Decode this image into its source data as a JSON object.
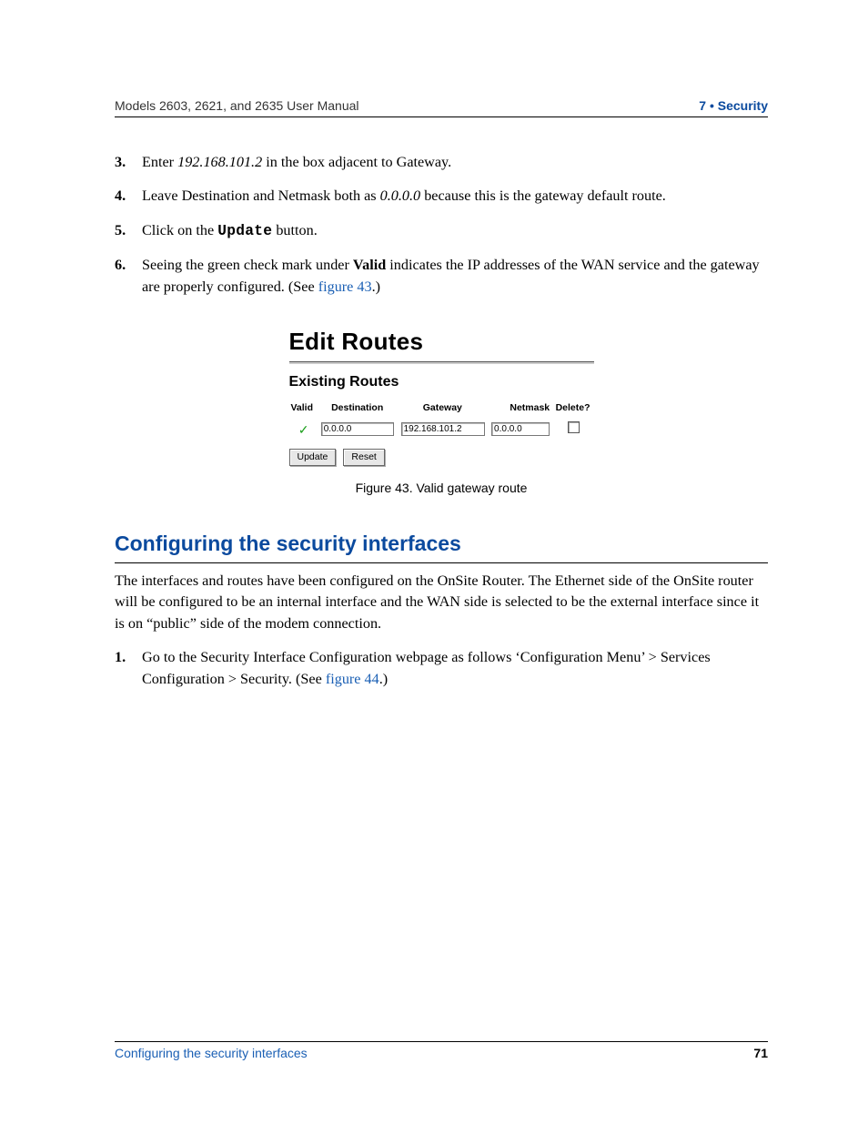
{
  "header": {
    "left": "Models 2603, 2621, and 2635 User Manual",
    "right": "7 • Security"
  },
  "steps_a": [
    {
      "num": "3.",
      "pre": "Enter ",
      "italic": "192.168.101.2",
      "post": " in the box adjacent to Gateway."
    },
    {
      "num": "4.",
      "pre": "Leave Destination and Netmask both as ",
      "italic": "0.0.0.0",
      "post": " because this is the gateway default route."
    },
    {
      "num": "5.",
      "pre": "Click on the ",
      "mono": "Update",
      "post": " button."
    },
    {
      "num": "6.",
      "pre": "Seeing the green check mark under ",
      "bold": "Valid",
      "mid": " indicates the IP addresses of the WAN service and the gateway are properly configured. (See ",
      "link": "figure 43",
      "post": ".)"
    }
  ],
  "figure": {
    "title": "Edit Routes",
    "subtitle": "Existing Routes",
    "cols": {
      "valid": "Valid",
      "dest": "Destination",
      "gw": "Gateway",
      "nm": "Netmask",
      "del": "Delete?"
    },
    "row": {
      "dest": "0.0.0.0",
      "gw": "192.168.101.2",
      "nm": "0.0.0.0"
    },
    "buttons": {
      "update": "Update",
      "reset": "Reset"
    },
    "caption": "Figure 43. Valid gateway route"
  },
  "section": {
    "heading": "Configuring the security interfaces",
    "para": "The interfaces and routes have been configured on the OnSite Router. The Ethernet side of the OnSite router will be configured to be an internal interface and the WAN side is selected to be the external interface since it is on “public” side of the modem connection."
  },
  "steps_b": [
    {
      "num": "1.",
      "pre": "Go to the Security Interface Configuration webpage as follows ‘Configuration Menu’ > Services Configuration > Security. (See ",
      "link": "figure 44",
      "post": ".)"
    }
  ],
  "footer": {
    "left": "Configuring the security interfaces",
    "right": "71"
  }
}
